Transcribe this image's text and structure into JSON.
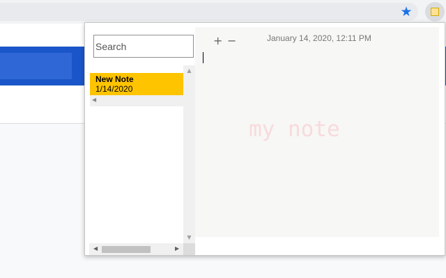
{
  "browser": {
    "bookmark_icon": "star-icon",
    "extension_icon": "sticky-note-icon",
    "accent_color": "#1a73e8"
  },
  "popup": {
    "search": {
      "placeholder": "Search",
      "value": ""
    },
    "notes": [
      {
        "title": "New Note",
        "date": "1/14/2020",
        "highlight_color": "#ffc400"
      }
    ],
    "toolbar": {
      "add_label": "+",
      "remove_label": "−"
    },
    "editor": {
      "timestamp": "January 14, 2020, 12:11 PM",
      "body_text": "my note"
    }
  }
}
